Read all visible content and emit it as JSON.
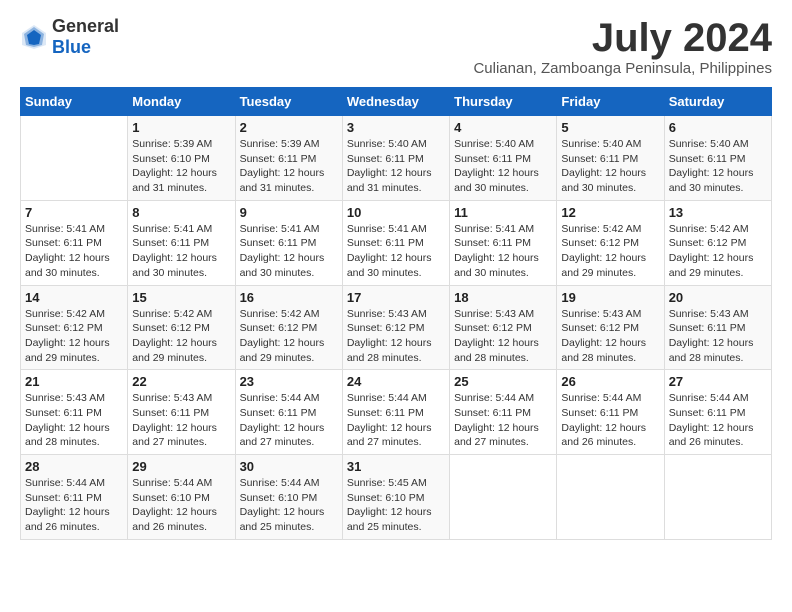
{
  "header": {
    "logo_general": "General",
    "logo_blue": "Blue",
    "month_title": "July 2024",
    "location": "Culianan, Zamboanga Peninsula, Philippines"
  },
  "calendar": {
    "days_of_week": [
      "Sunday",
      "Monday",
      "Tuesday",
      "Wednesday",
      "Thursday",
      "Friday",
      "Saturday"
    ],
    "weeks": [
      [
        {
          "day": "",
          "sunrise": "",
          "sunset": "",
          "daylight": ""
        },
        {
          "day": "1",
          "sunrise": "Sunrise: 5:39 AM",
          "sunset": "Sunset: 6:10 PM",
          "daylight": "Daylight: 12 hours and 31 minutes."
        },
        {
          "day": "2",
          "sunrise": "Sunrise: 5:39 AM",
          "sunset": "Sunset: 6:11 PM",
          "daylight": "Daylight: 12 hours and 31 minutes."
        },
        {
          "day": "3",
          "sunrise": "Sunrise: 5:40 AM",
          "sunset": "Sunset: 6:11 PM",
          "daylight": "Daylight: 12 hours and 31 minutes."
        },
        {
          "day": "4",
          "sunrise": "Sunrise: 5:40 AM",
          "sunset": "Sunset: 6:11 PM",
          "daylight": "Daylight: 12 hours and 30 minutes."
        },
        {
          "day": "5",
          "sunrise": "Sunrise: 5:40 AM",
          "sunset": "Sunset: 6:11 PM",
          "daylight": "Daylight: 12 hours and 30 minutes."
        },
        {
          "day": "6",
          "sunrise": "Sunrise: 5:40 AM",
          "sunset": "Sunset: 6:11 PM",
          "daylight": "Daylight: 12 hours and 30 minutes."
        }
      ],
      [
        {
          "day": "7",
          "sunrise": "Sunrise: 5:41 AM",
          "sunset": "Sunset: 6:11 PM",
          "daylight": "Daylight: 12 hours and 30 minutes."
        },
        {
          "day": "8",
          "sunrise": "Sunrise: 5:41 AM",
          "sunset": "Sunset: 6:11 PM",
          "daylight": "Daylight: 12 hours and 30 minutes."
        },
        {
          "day": "9",
          "sunrise": "Sunrise: 5:41 AM",
          "sunset": "Sunset: 6:11 PM",
          "daylight": "Daylight: 12 hours and 30 minutes."
        },
        {
          "day": "10",
          "sunrise": "Sunrise: 5:41 AM",
          "sunset": "Sunset: 6:11 PM",
          "daylight": "Daylight: 12 hours and 30 minutes."
        },
        {
          "day": "11",
          "sunrise": "Sunrise: 5:41 AM",
          "sunset": "Sunset: 6:11 PM",
          "daylight": "Daylight: 12 hours and 30 minutes."
        },
        {
          "day": "12",
          "sunrise": "Sunrise: 5:42 AM",
          "sunset": "Sunset: 6:12 PM",
          "daylight": "Daylight: 12 hours and 29 minutes."
        },
        {
          "day": "13",
          "sunrise": "Sunrise: 5:42 AM",
          "sunset": "Sunset: 6:12 PM",
          "daylight": "Daylight: 12 hours and 29 minutes."
        }
      ],
      [
        {
          "day": "14",
          "sunrise": "Sunrise: 5:42 AM",
          "sunset": "Sunset: 6:12 PM",
          "daylight": "Daylight: 12 hours and 29 minutes."
        },
        {
          "day": "15",
          "sunrise": "Sunrise: 5:42 AM",
          "sunset": "Sunset: 6:12 PM",
          "daylight": "Daylight: 12 hours and 29 minutes."
        },
        {
          "day": "16",
          "sunrise": "Sunrise: 5:42 AM",
          "sunset": "Sunset: 6:12 PM",
          "daylight": "Daylight: 12 hours and 29 minutes."
        },
        {
          "day": "17",
          "sunrise": "Sunrise: 5:43 AM",
          "sunset": "Sunset: 6:12 PM",
          "daylight": "Daylight: 12 hours and 28 minutes."
        },
        {
          "day": "18",
          "sunrise": "Sunrise: 5:43 AM",
          "sunset": "Sunset: 6:12 PM",
          "daylight": "Daylight: 12 hours and 28 minutes."
        },
        {
          "day": "19",
          "sunrise": "Sunrise: 5:43 AM",
          "sunset": "Sunset: 6:12 PM",
          "daylight": "Daylight: 12 hours and 28 minutes."
        },
        {
          "day": "20",
          "sunrise": "Sunrise: 5:43 AM",
          "sunset": "Sunset: 6:11 PM",
          "daylight": "Daylight: 12 hours and 28 minutes."
        }
      ],
      [
        {
          "day": "21",
          "sunrise": "Sunrise: 5:43 AM",
          "sunset": "Sunset: 6:11 PM",
          "daylight": "Daylight: 12 hours and 28 minutes."
        },
        {
          "day": "22",
          "sunrise": "Sunrise: 5:43 AM",
          "sunset": "Sunset: 6:11 PM",
          "daylight": "Daylight: 12 hours and 27 minutes."
        },
        {
          "day": "23",
          "sunrise": "Sunrise: 5:44 AM",
          "sunset": "Sunset: 6:11 PM",
          "daylight": "Daylight: 12 hours and 27 minutes."
        },
        {
          "day": "24",
          "sunrise": "Sunrise: 5:44 AM",
          "sunset": "Sunset: 6:11 PM",
          "daylight": "Daylight: 12 hours and 27 minutes."
        },
        {
          "day": "25",
          "sunrise": "Sunrise: 5:44 AM",
          "sunset": "Sunset: 6:11 PM",
          "daylight": "Daylight: 12 hours and 27 minutes."
        },
        {
          "day": "26",
          "sunrise": "Sunrise: 5:44 AM",
          "sunset": "Sunset: 6:11 PM",
          "daylight": "Daylight: 12 hours and 26 minutes."
        },
        {
          "day": "27",
          "sunrise": "Sunrise: 5:44 AM",
          "sunset": "Sunset: 6:11 PM",
          "daylight": "Daylight: 12 hours and 26 minutes."
        }
      ],
      [
        {
          "day": "28",
          "sunrise": "Sunrise: 5:44 AM",
          "sunset": "Sunset: 6:11 PM",
          "daylight": "Daylight: 12 hours and 26 minutes."
        },
        {
          "day": "29",
          "sunrise": "Sunrise: 5:44 AM",
          "sunset": "Sunset: 6:10 PM",
          "daylight": "Daylight: 12 hours and 26 minutes."
        },
        {
          "day": "30",
          "sunrise": "Sunrise: 5:44 AM",
          "sunset": "Sunset: 6:10 PM",
          "daylight": "Daylight: 12 hours and 25 minutes."
        },
        {
          "day": "31",
          "sunrise": "Sunrise: 5:45 AM",
          "sunset": "Sunset: 6:10 PM",
          "daylight": "Daylight: 12 hours and 25 minutes."
        },
        {
          "day": "",
          "sunrise": "",
          "sunset": "",
          "daylight": ""
        },
        {
          "day": "",
          "sunrise": "",
          "sunset": "",
          "daylight": ""
        },
        {
          "day": "",
          "sunrise": "",
          "sunset": "",
          "daylight": ""
        }
      ]
    ]
  }
}
